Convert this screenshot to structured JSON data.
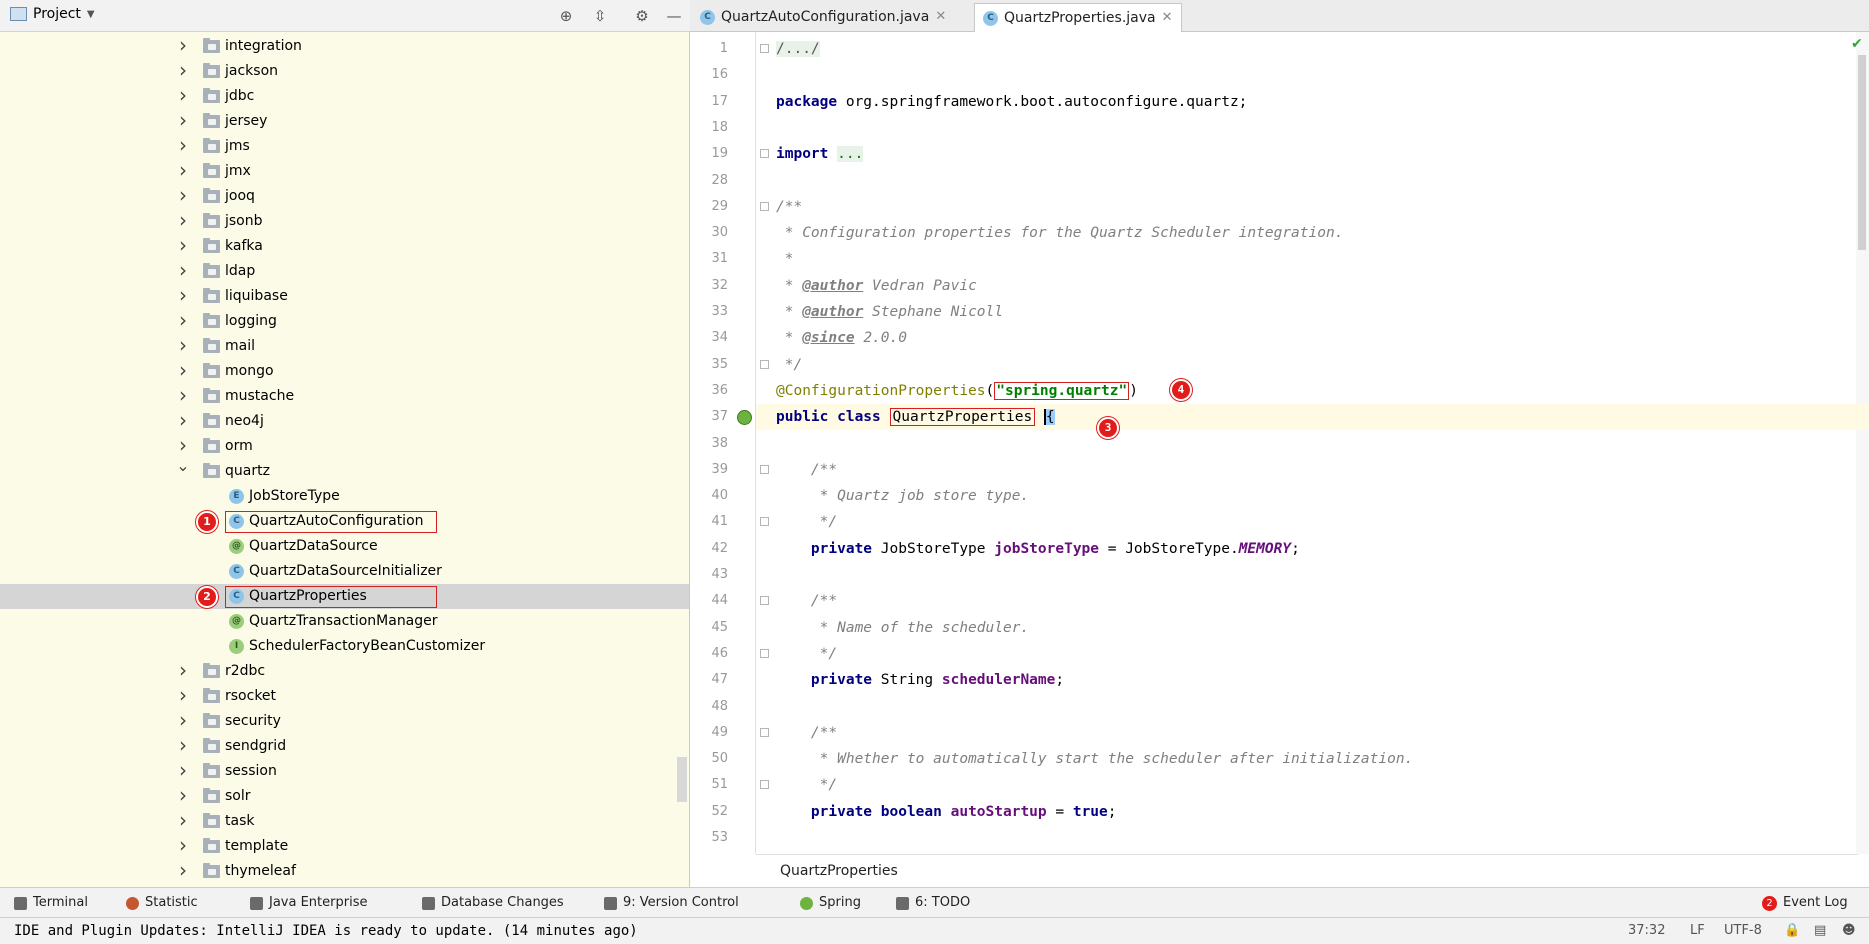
{
  "project_panel": {
    "title": "Project",
    "folders_above": [
      "integration",
      "jackson",
      "jdbc",
      "jersey",
      "jms",
      "jmx",
      "jooq",
      "jsonb",
      "kafka",
      "ldap",
      "liquibase",
      "logging",
      "mail",
      "mongo",
      "mustache",
      "neo4j",
      "orm"
    ],
    "expanded_folder": "quartz",
    "quartz_children": [
      {
        "kind": "E",
        "name": "JobStoreType"
      },
      {
        "kind": "C",
        "name": "QuartzAutoConfiguration",
        "badge": "1"
      },
      {
        "kind": "@",
        "name": "QuartzDataSource"
      },
      {
        "kind": "C",
        "name": "QuartzDataSourceInitializer"
      },
      {
        "kind": "C",
        "name": "QuartzProperties",
        "badge": "2",
        "selected": true
      },
      {
        "kind": "@",
        "name": "QuartzTransactionManager"
      },
      {
        "kind": "I",
        "name": "SchedulerFactoryBeanCustomizer"
      }
    ],
    "folders_below": [
      "r2dbc",
      "rsocket",
      "security",
      "sendgrid",
      "session",
      "solr",
      "task",
      "template",
      "thymeleaf"
    ]
  },
  "editor": {
    "tabs": [
      {
        "label": "QuartzAutoConfiguration.java",
        "active": false
      },
      {
        "label": "QuartzProperties.java",
        "active": true
      }
    ],
    "breadcrumb": "QuartzProperties",
    "annotations": {
      "class_name_badge": "3",
      "prefix_badge": "4"
    },
    "lines": {
      "l1": {
        "num": "1",
        "text": "/.../"
      },
      "l16": {
        "num": "16"
      },
      "l17": {
        "num": "17",
        "kw": "package",
        "rest": " org.springframework.boot.autoconfigure.quartz;"
      },
      "l18": {
        "num": "18"
      },
      "l19": {
        "num": "19",
        "kw": "import",
        "rest": "..."
      },
      "l28": {
        "num": "28"
      },
      "l29": {
        "num": "29",
        "text": "/**"
      },
      "l30": {
        "num": "30",
        "text": " * Configuration properties for the Quartz Scheduler integration."
      },
      "l31": {
        "num": "31",
        "text": " *"
      },
      "l32": {
        "num": "32",
        "tag": "@author",
        "rest": " Vedran Pavic"
      },
      "l33": {
        "num": "33",
        "tag": "@author",
        "rest": " Stephane Nicoll"
      },
      "l34": {
        "num": "34",
        "tag": "@since",
        "rest": " 2.0.0"
      },
      "l35": {
        "num": "35",
        "text": " */"
      },
      "l36": {
        "num": "36",
        "ann": "@ConfigurationProperties",
        "str": "\"spring.quartz\""
      },
      "l37": {
        "num": "37",
        "kw": "public class",
        "cls": "QuartzProperties",
        "brace": "{"
      },
      "l38": {
        "num": "38"
      },
      "l39": {
        "num": "39",
        "text": "/**"
      },
      "l40": {
        "num": "40",
        "text": " * Quartz job store type."
      },
      "l41": {
        "num": "41",
        "text": " */"
      },
      "l42": {
        "num": "42",
        "kw": "private",
        "type": " JobStoreType ",
        "field": "jobStoreType",
        "eq": " = JobStoreType.",
        "sfield": "MEMORY",
        "end": ";"
      },
      "l43": {
        "num": "43"
      },
      "l44": {
        "num": "44",
        "text": "/**"
      },
      "l45": {
        "num": "45",
        "text": " * Name of the scheduler."
      },
      "l46": {
        "num": "46",
        "text": " */"
      },
      "l47": {
        "num": "47",
        "kw": "private",
        "type": " String ",
        "field": "schedulerName",
        "end": ";"
      },
      "l48": {
        "num": "48"
      },
      "l49": {
        "num": "49",
        "text": "/**"
      },
      "l50": {
        "num": "50",
        "text": " * Whether to automatically start the scheduler after initialization."
      },
      "l51": {
        "num": "51",
        "text": " */"
      },
      "l52": {
        "num": "52",
        "kw": "private boolean",
        "field": "autoStartup",
        "eq": " = ",
        "kw2": "true",
        "end": ";"
      },
      "l53": {
        "num": "53"
      }
    }
  },
  "bottom_toolbar": [
    {
      "label": "Terminal"
    },
    {
      "label": "Statistic"
    },
    {
      "label": "Java Enterprise"
    },
    {
      "label": "Database Changes"
    },
    {
      "label": "9: Version Control"
    },
    {
      "label": "Spring"
    },
    {
      "label": "6: TODO"
    }
  ],
  "event_log": {
    "label": "Event Log",
    "count": "2"
  },
  "status": {
    "message": "IDE and Plugin Updates: IntelliJ IDEA is ready to update. (14 minutes ago)",
    "position": "37:32",
    "line_sep": "LF",
    "encoding": "UTF-8"
  },
  "colors": {
    "accent_red": "#e21b1b",
    "tree_bg": "#fbfbe8",
    "keyword": "#000080",
    "string": "#008000"
  }
}
